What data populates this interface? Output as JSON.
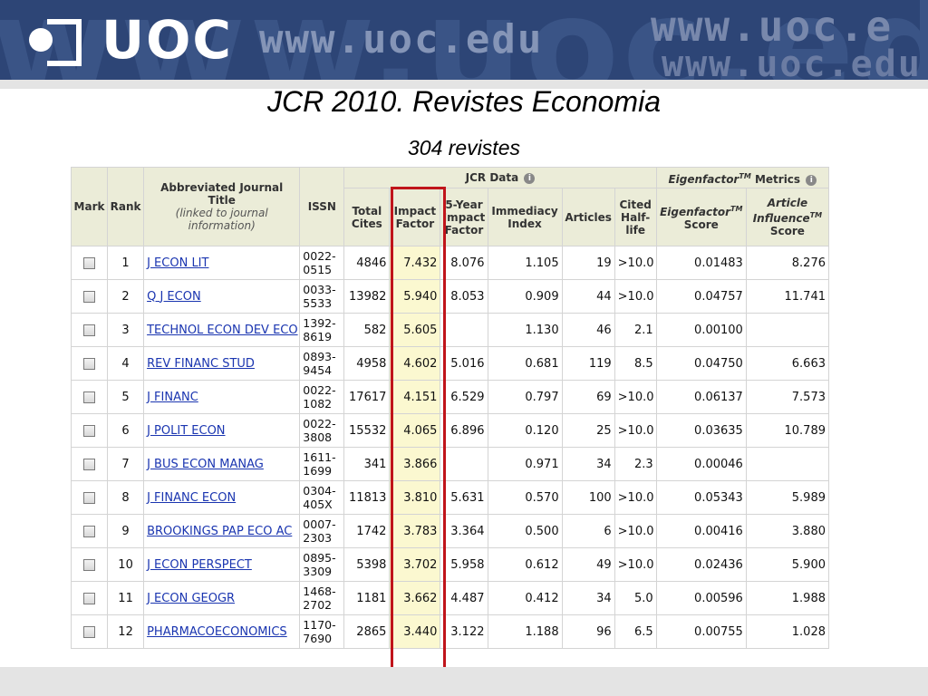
{
  "header": {
    "logo_text": "UOC",
    "url_text": "www.uoc.edu",
    "url_text_right": "www.uoc.e",
    "url_text_right2": "www.uoc.edu",
    "background_watermark": "www.uoc.edu"
  },
  "slide": {
    "title": "JCR 2010. Revistes Economia",
    "subtitle": "304 revistes"
  },
  "table": {
    "group_headers": {
      "jcr_data": "JCR Data",
      "eigenfactor_metrics": "Eigenfactor",
      "eigenfactor_metrics_tm": "TM",
      "eigenfactor_metrics_suffix": " Metrics"
    },
    "columns": {
      "mark": "Mark",
      "rank": "Rank",
      "title_main": "Abbreviated Journal Title",
      "title_sub": "(linked to journal information)",
      "issn": "ISSN",
      "total_cites": "Total Cites",
      "impact_factor": "Impact Factor",
      "five_year_if": "5-Year Impact Factor",
      "immediacy_index": "Immediacy Index",
      "articles": "Articles",
      "cited_half_life": "Cited Half-life",
      "eigenfactor_score": "Eigenfactor",
      "eigenfactor_score_tm": "TM",
      "eigenfactor_score_suffix": "Score",
      "article_influence": "Article Influence",
      "article_influence_tm": "TM",
      "article_influence_suffix": "Score"
    },
    "rows": [
      {
        "rank": "1",
        "title": "J ECON LIT",
        "issn1": "0022-",
        "issn2": "0515",
        "total_cites": "4846",
        "impact_factor": "7.432",
        "five_year": "8.076",
        "immediacy": "1.105",
        "articles": "19",
        "half_life": ">10.0",
        "eigenfactor": "0.01483",
        "influence": "8.276"
      },
      {
        "rank": "2",
        "title": "Q J ECON",
        "issn1": "0033-",
        "issn2": "5533",
        "total_cites": "13982",
        "impact_factor": "5.940",
        "five_year": "8.053",
        "immediacy": "0.909",
        "articles": "44",
        "half_life": ">10.0",
        "eigenfactor": "0.04757",
        "influence": "11.741"
      },
      {
        "rank": "3",
        "title": "TECHNOL ECON DEV ECO",
        "issn1": "1392-",
        "issn2": "8619",
        "total_cites": "582",
        "impact_factor": "5.605",
        "five_year": "",
        "immediacy": "1.130",
        "articles": "46",
        "half_life": "2.1",
        "eigenfactor": "0.00100",
        "influence": ""
      },
      {
        "rank": "4",
        "title": "REV FINANC STUD",
        "issn1": "0893-",
        "issn2": "9454",
        "total_cites": "4958",
        "impact_factor": "4.602",
        "five_year": "5.016",
        "immediacy": "0.681",
        "articles": "119",
        "half_life": "8.5",
        "eigenfactor": "0.04750",
        "influence": "6.663"
      },
      {
        "rank": "5",
        "title": "J FINANC",
        "issn1": "0022-",
        "issn2": "1082",
        "total_cites": "17617",
        "impact_factor": "4.151",
        "five_year": "6.529",
        "immediacy": "0.797",
        "articles": "69",
        "half_life": ">10.0",
        "eigenfactor": "0.06137",
        "influence": "7.573"
      },
      {
        "rank": "6",
        "title": "J POLIT ECON",
        "issn1": "0022-",
        "issn2": "3808",
        "total_cites": "15532",
        "impact_factor": "4.065",
        "five_year": "6.896",
        "immediacy": "0.120",
        "articles": "25",
        "half_life": ">10.0",
        "eigenfactor": "0.03635",
        "influence": "10.789"
      },
      {
        "rank": "7",
        "title": "J BUS ECON MANAG",
        "issn1": "1611-",
        "issn2": "1699",
        "total_cites": "341",
        "impact_factor": "3.866",
        "five_year": "",
        "immediacy": "0.971",
        "articles": "34",
        "half_life": "2.3",
        "eigenfactor": "0.00046",
        "influence": ""
      },
      {
        "rank": "8",
        "title": "J FINANC ECON",
        "issn1": "0304-",
        "issn2": "405X",
        "total_cites": "11813",
        "impact_factor": "3.810",
        "five_year": "5.631",
        "immediacy": "0.570",
        "articles": "100",
        "half_life": ">10.0",
        "eigenfactor": "0.05343",
        "influence": "5.989"
      },
      {
        "rank": "9",
        "title": "BROOKINGS PAP ECO AC",
        "issn1": "0007-",
        "issn2": "2303",
        "total_cites": "1742",
        "impact_factor": "3.783",
        "five_year": "3.364",
        "immediacy": "0.500",
        "articles": "6",
        "half_life": ">10.0",
        "eigenfactor": "0.00416",
        "influence": "3.880"
      },
      {
        "rank": "10",
        "title": "J ECON PERSPECT",
        "issn1": "0895-",
        "issn2": "3309",
        "total_cites": "5398",
        "impact_factor": "3.702",
        "five_year": "5.958",
        "immediacy": "0.612",
        "articles": "49",
        "half_life": ">10.0",
        "eigenfactor": "0.02436",
        "influence": "5.900"
      },
      {
        "rank": "11",
        "title": "J ECON GEOGR",
        "issn1": "1468-",
        "issn2": "2702",
        "total_cites": "1181",
        "impact_factor": "3.662",
        "five_year": "4.487",
        "immediacy": "0.412",
        "articles": "34",
        "half_life": "5.0",
        "eigenfactor": "0.00596",
        "influence": "1.988"
      },
      {
        "rank": "12",
        "title": "PHARMACOECONOMICS",
        "issn1": "1170-",
        "issn2": "7690",
        "total_cites": "2865",
        "impact_factor": "3.440",
        "five_year": "3.122",
        "immediacy": "1.188",
        "articles": "96",
        "half_life": "6.5",
        "eigenfactor": "0.00755",
        "influence": "1.028"
      }
    ]
  },
  "colors": {
    "banner": "#2d4576",
    "header_bg": "#ebecd8",
    "impact_highlight_bg": "#fbf8d0",
    "highlight_border": "#c0141b",
    "link": "#1a35b0"
  },
  "icons": {
    "info": "info-icon",
    "checkbox": "checkbox-icon"
  }
}
